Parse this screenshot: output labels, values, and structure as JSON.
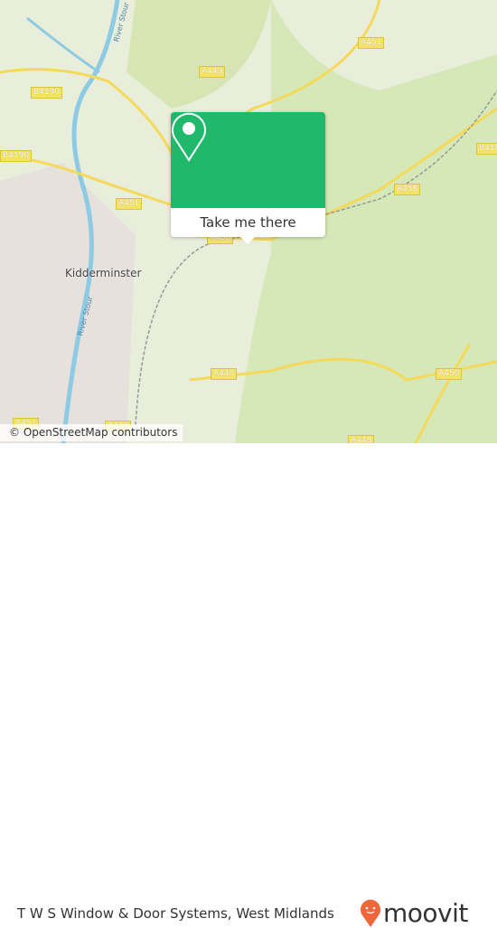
{
  "map": {
    "place": "Kidderminster",
    "rivers": [
      "River Stour",
      "River Stour"
    ],
    "road_labels": [
      "A451",
      "A449",
      "B4190",
      "B4190",
      "A451",
      "A456",
      "A456",
      "A448",
      "A448",
      "A450",
      "A451",
      "A448",
      "B418"
    ],
    "attribution": "© OpenStreetMap contributors"
  },
  "popup": {
    "icon": "map-pin-icon",
    "button_label": "Take me there",
    "color": "#20b86b"
  },
  "footer": {
    "title": "T W S Window & Door Systems, West Midlands",
    "logo_text": "moovit",
    "logo_color": "#f0663b"
  }
}
